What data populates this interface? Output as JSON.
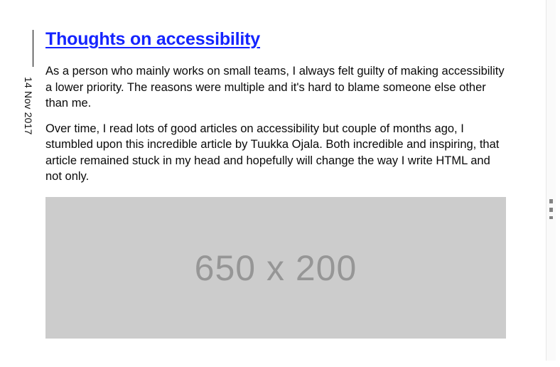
{
  "post": {
    "date": "14 Nov 2017",
    "title": "Thoughts on accessibility",
    "paragraphs": [
      "As a person who mainly works on small teams, I always felt guilty of making accessibility a lower priority. The reasons were multiple and it's hard to blame someone else other than me.",
      "Over time, I read lots of good articles on accessibility but couple of months ago, I stumbled upon this incredible article by Tuukka Ojala. Both incredible and inspiring, that article remained stuck in my head and hopefully will change the way I write HTML and not only."
    ],
    "image_placeholder_label": "650 x 200"
  }
}
